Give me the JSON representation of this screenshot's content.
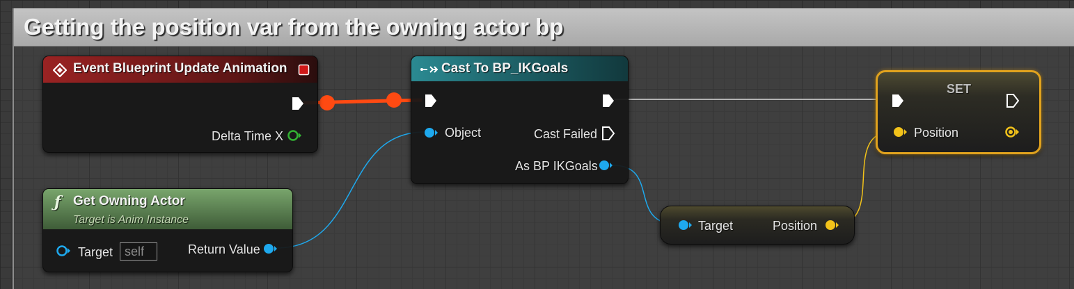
{
  "comment": {
    "title": "Getting the position var from the owning actor bp"
  },
  "colors": {
    "event_header": "#8f1d1d",
    "cast_header": "#1d5e63",
    "function_header": "#5d8451",
    "object_pin": "#1ea9ee",
    "vector_pin": "#f2c21a",
    "float_pin": "#33b233",
    "exec_wire": "#ff4a12",
    "selection_outline": "#e0a21e"
  },
  "event_node": {
    "title": "Event Blueprint Update Animation",
    "output_label": "Delta Time X",
    "icon": "event-diamond-icon"
  },
  "get_owning_actor": {
    "title": "Get Owning Actor",
    "subtitle": "Target is Anim Instance",
    "target_label": "Target",
    "target_value": "self",
    "return_label": "Return Value",
    "icon": "function-icon"
  },
  "cast_node": {
    "title": "Cast To BP_IKGoals",
    "object_label": "Object",
    "cast_failed_label": "Cast Failed",
    "as_label": "As BP IKGoals",
    "icon": "cast-icon"
  },
  "get_position_node": {
    "target_label": "Target",
    "position_label": "Position"
  },
  "set_node": {
    "title": "SET",
    "position_label": "Position"
  }
}
